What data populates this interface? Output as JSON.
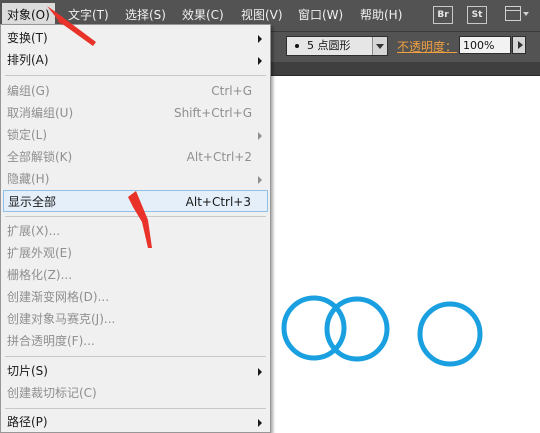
{
  "menubar": {
    "items": [
      "对象(O)",
      "文字(T)",
      "选择(S)",
      "效果(C)",
      "视图(V)",
      "窗口(W)",
      "帮助(H)"
    ],
    "bridge_btn": "Br",
    "stock_btn": "St"
  },
  "control": {
    "brush_label": "5 点圆形",
    "opacity_label": "不透明度：",
    "opacity_value": "100%"
  },
  "menu": {
    "transform": "变换(T)",
    "arrange": "排列(A)",
    "group": "编组(G)",
    "group_sc": "Ctrl+G",
    "ungroup": "取消编组(U)",
    "ungroup_sc": "Shift+Ctrl+G",
    "lock": "锁定(L)",
    "unlock_all": "全部解锁(K)",
    "unlock_all_sc": "Alt+Ctrl+2",
    "hide": "隐藏(H)",
    "show_all": "显示全部",
    "show_all_sc": "Alt+Ctrl+3",
    "expand": "扩展(X)...",
    "expand_appearance": "扩展外观(E)",
    "rasterize": "栅格化(Z)...",
    "gradient_mesh": "创建渐变网格(D)...",
    "object_mosaic": "创建对象马赛克(J)...",
    "flatten_transparency": "拼合透明度(F)...",
    "slice": "切片(S)",
    "crop_marks": "创建裁切标记(C)",
    "path": "路径(P)"
  },
  "colors": {
    "circle_stroke": "#1aa0e0",
    "annotation_arrow": "#e8322a"
  }
}
